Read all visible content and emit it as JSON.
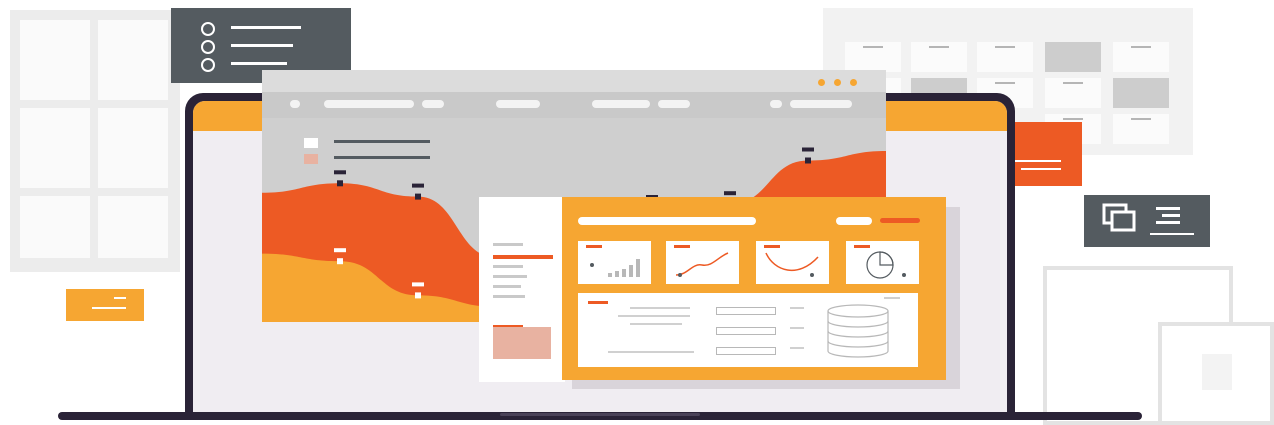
{
  "colors": {
    "accent_orange": "#f6a632",
    "accent_red_orange": "#ed5a24",
    "dark_slate": "#545b60",
    "laptop_frame": "#2a2337",
    "light_gray": "#cfcfcf"
  },
  "icons": {
    "list": "bullet-list-icon",
    "cards": "stacked-cards-icon",
    "database": "database-icon",
    "window_controls": "window-dots-icon"
  },
  "chart_data": {
    "type": "area",
    "title": "",
    "xlabel": "",
    "ylabel": "",
    "series": [
      {
        "values": [
          68,
          73,
          66,
          34,
          52,
          60,
          62,
          85,
          90
        ]
      },
      {
        "values": [
          36,
          32,
          14,
          8,
          20,
          28,
          30,
          40,
          45
        ]
      }
    ]
  },
  "mini_charts": [
    {
      "type": "bar",
      "values": [
        2,
        3,
        4,
        6,
        9
      ]
    },
    {
      "type": "line"
    },
    {
      "type": "line"
    },
    {
      "type": "pie",
      "values": [
        75,
        25
      ]
    }
  ]
}
